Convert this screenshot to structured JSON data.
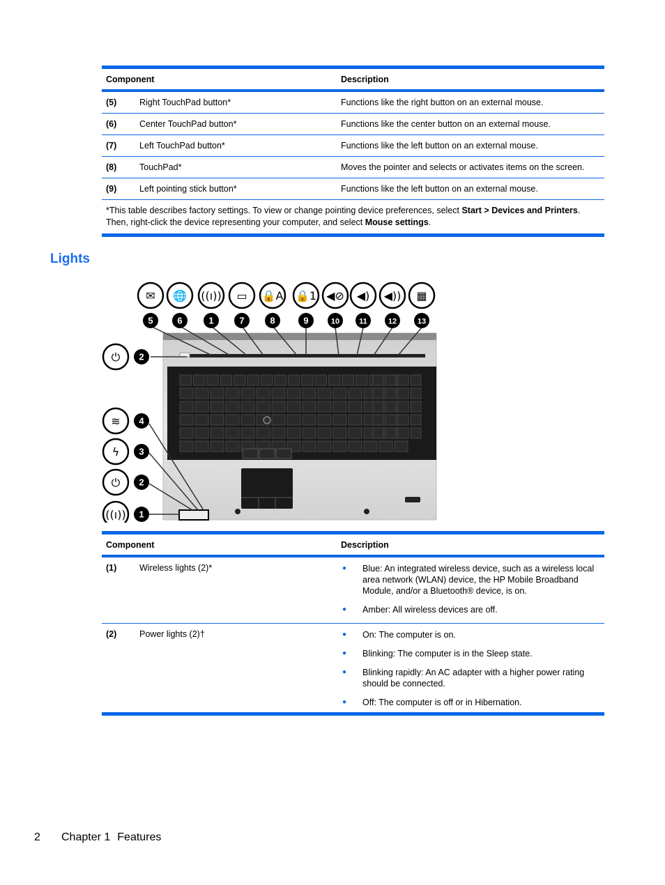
{
  "table1": {
    "headers": {
      "component": "Component",
      "description": "Description"
    },
    "rows": [
      {
        "num": "(5)",
        "component": "Right TouchPad button*",
        "description": "Functions like the right button on an external mouse."
      },
      {
        "num": "(6)",
        "component": "Center TouchPad button*",
        "description": "Functions like the center button on an external mouse."
      },
      {
        "num": "(7)",
        "component": "Left TouchPad button*",
        "description": "Functions like the left button on an external mouse."
      },
      {
        "num": "(8)",
        "component": "TouchPad*",
        "description": "Moves the pointer and selects or activates items on the screen."
      },
      {
        "num": "(9)",
        "component": "Left pointing stick button*",
        "description": "Functions like the left button on an external mouse."
      }
    ],
    "note": {
      "part1": "*This table describes factory settings. To view or change pointing device preferences, select ",
      "bold1": "Start > Devices and Printers",
      "part2": ". Then, right-click the device representing your computer, and select ",
      "bold2": "Mouse settings",
      "part3": "."
    }
  },
  "section": {
    "title": "Lights"
  },
  "figure": {
    "top_callouts": [
      "5",
      "6",
      "1",
      "7",
      "8",
      "9",
      "10",
      "11",
      "12",
      "13"
    ],
    "top_icons": [
      "mail-presentation-icon",
      "globe-icon",
      "wireless-icon",
      "touchpad-icon",
      "caps-lock-icon",
      "num-lock-icon",
      "volume-mute-icon",
      "volume-down-icon",
      "volume-up-icon",
      "calculator-icon"
    ],
    "side_callout_power": "2",
    "left_callouts": [
      "4",
      "3",
      "2",
      "1"
    ],
    "left_icons": [
      "drive-icon",
      "battery-lightning-icon",
      "power-icon",
      "wireless-icon"
    ]
  },
  "table2": {
    "headers": {
      "component": "Component",
      "description": "Description"
    },
    "rows": [
      {
        "num": "(1)",
        "component": "Wireless lights (2)*",
        "bullets": [
          "Blue: An integrated wireless device, such as a wireless local area network (WLAN) device, the HP Mobile Broadband Module, and/or a Bluetooth® device, is on.",
          "Amber: All wireless devices are off."
        ]
      },
      {
        "num": "(2)",
        "component": "Power lights (2)†",
        "bullets": [
          "On: The computer is on.",
          "Blinking: The computer is in the Sleep state.",
          "Blinking rapidly: An AC adapter with a higher power rating should be connected.",
          "Off: The computer is off or in Hibernation."
        ]
      }
    ]
  },
  "footer": {
    "page": "2",
    "chapter": "Chapter 1",
    "title": "Features"
  }
}
